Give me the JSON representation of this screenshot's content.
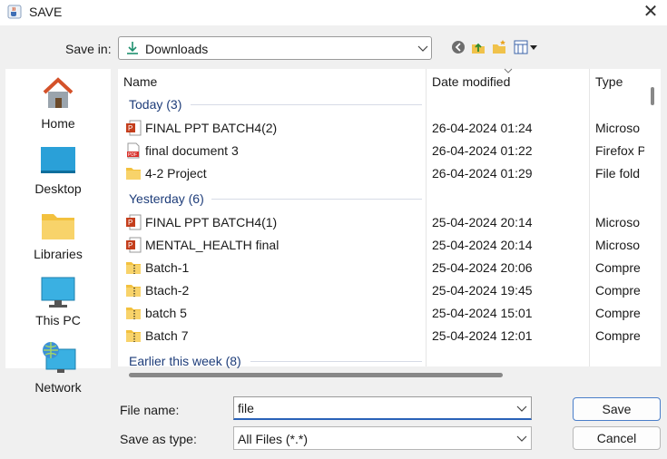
{
  "window": {
    "title": "SAVE",
    "icon": "java-coffee-icon",
    "close_glyph": "✕"
  },
  "toolbar": {
    "save_in_label": "Save in:",
    "location": "Downloads",
    "location_icon": "download-arrow-icon",
    "icons": [
      "back-icon",
      "up-folder-icon",
      "new-folder-icon",
      "view-menu-icon"
    ]
  },
  "places": [
    {
      "label": "Home",
      "icon": "house-icon"
    },
    {
      "label": "Desktop",
      "icon": "desktop-icon"
    },
    {
      "label": "Libraries",
      "icon": "folder-icon"
    },
    {
      "label": "This PC",
      "icon": "monitor-icon"
    },
    {
      "label": "Network",
      "icon": "network-globe-icon"
    }
  ],
  "columns": {
    "name": "Name",
    "date": "Date modified",
    "type": "Type"
  },
  "groups": [
    {
      "label": "Today (3)"
    },
    {
      "label": "Yesterday (6)"
    },
    {
      "label": "Earlier this week (8)"
    }
  ],
  "rows": [
    {
      "name": "FINAL PPT BATCH4(2)",
      "date": "26-04-2024 01:24",
      "type": "Microso",
      "icon": "powerpoint-icon"
    },
    {
      "name": "final document 3",
      "date": "26-04-2024 01:22",
      "type": "Firefox P",
      "icon": "pdf-icon"
    },
    {
      "name": "4-2 Project",
      "date": "26-04-2024 01:29",
      "type": "File fold",
      "icon": "folder-icon"
    },
    {
      "name": "FINAL PPT BATCH4(1)",
      "date": "25-04-2024 20:14",
      "type": "Microso",
      "icon": "powerpoint-icon"
    },
    {
      "name": "MENTAL_HEALTH final",
      "date": "25-04-2024 20:14",
      "type": "Microso",
      "icon": "powerpoint-icon"
    },
    {
      "name": "Batch-1",
      "date": "25-04-2024 20:06",
      "type": "Compre",
      "icon": "zip-folder-icon"
    },
    {
      "name": "Btach-2",
      "date": "25-04-2024 19:45",
      "type": "Compre",
      "icon": "zip-folder-icon"
    },
    {
      "name": "batch 5",
      "date": "25-04-2024 15:01",
      "type": "Compre",
      "icon": "zip-folder-icon"
    },
    {
      "name": "Batch 7",
      "date": "25-04-2024 12:01",
      "type": "Compre",
      "icon": "zip-folder-icon"
    }
  ],
  "file_name": {
    "label": "File name:",
    "value": "file"
  },
  "save_as_type": {
    "label": "Save as type:",
    "value": "All Files (*.*)"
  },
  "buttons": {
    "save": "Save",
    "cancel": "Cancel"
  },
  "colors": {
    "accent": "#2a62b8",
    "group_text": "#1e3d7a"
  }
}
